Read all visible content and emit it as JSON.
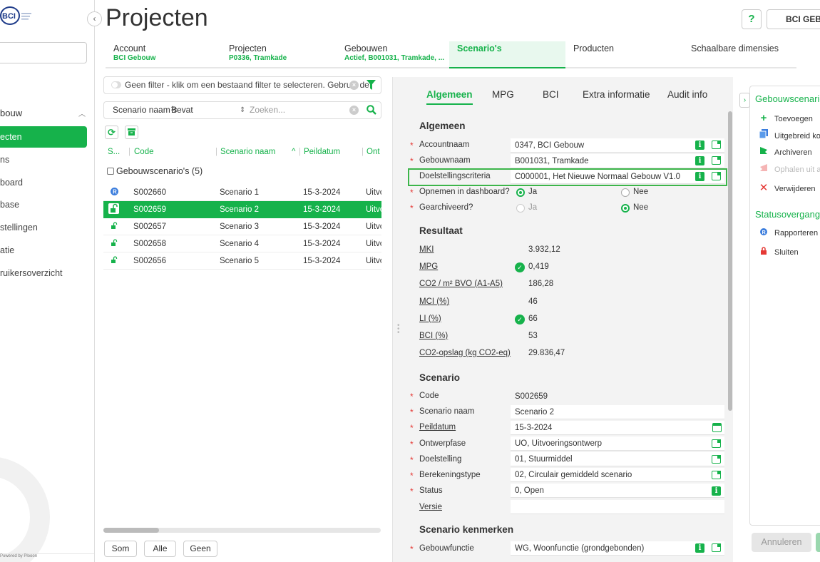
{
  "header": {
    "title": "Projecten",
    "help_label": "?",
    "org_label": "BCI GEBOUW"
  },
  "sidebar": {
    "logo_text": "BCI",
    "group_label": "bouw",
    "items": [
      "ecten",
      "ns",
      "board",
      "base",
      "stellingen",
      "atie",
      "ruikersoverzicht"
    ],
    "active_index": 0,
    "powered": "Powered by Plooon"
  },
  "crumbs": [
    {
      "label": "Account",
      "sub": "BCI Gebouw"
    },
    {
      "label": "Projecten",
      "sub": "P0336, Tramkade"
    },
    {
      "label": "Gebouwen",
      "sub": "Actief, B001031, Tramkade, ..."
    },
    {
      "label": "Scenario's",
      "sub": ""
    },
    {
      "label": "Producten",
      "sub": ""
    },
    {
      "label": "Schaalbare dimensies",
      "sub": ""
    }
  ],
  "list": {
    "filter_text": "Geen filter - klik om een bestaand filter te selecteren. Gebruik de",
    "search_field": "Scenario naam",
    "search_operator": "Bevat",
    "search_placeholder": "Zoeken...",
    "columns": [
      "S...",
      "Code",
      "Scenario naam",
      "Peildatum",
      "Ont"
    ],
    "group_label": "Gebouwscenario's (5)",
    "rows": [
      {
        "icon": "R",
        "code": "S002660",
        "name": "Scenario 1",
        "date": "15-3-2024",
        "phase": "Uitvo"
      },
      {
        "icon": "open-lock",
        "code": "S002659",
        "name": "Scenario 2",
        "date": "15-3-2024",
        "phase": "Uitvo"
      },
      {
        "icon": "open-lock",
        "code": "S002657",
        "name": "Scenario 3",
        "date": "15-3-2024",
        "phase": "Uitvo"
      },
      {
        "icon": "open-lock",
        "code": "S002658",
        "name": "Scenario 4",
        "date": "15-3-2024",
        "phase": "Uitvo"
      },
      {
        "icon": "open-lock",
        "code": "S002656",
        "name": "Scenario 5",
        "date": "15-3-2024",
        "phase": "Uitvo"
      }
    ],
    "selected_index": 1,
    "buttons": [
      "Som",
      "Alle",
      "Geen"
    ]
  },
  "detail": {
    "tabs": [
      "Algemeen",
      "MPG",
      "BCI",
      "Extra informatie",
      "Audit info"
    ],
    "sections": {
      "algemeen": "Algemeen",
      "resultaat": "Resultaat",
      "scenario": "Scenario",
      "kenmerken": "Scenario kenmerken"
    },
    "algemeen": {
      "accountnaam": {
        "label": "Accountnaam",
        "value": "0347, BCI Gebouw"
      },
      "gebouwnaam": {
        "label": "Gebouwnaam",
        "value": "B001031, Tramkade"
      },
      "doelstellingscriteria": {
        "label": "Doelstellingscriteria",
        "value": "C000001, Het Nieuwe Normaal Gebouw V1.0"
      },
      "opnemen": {
        "label": "Opnemen in dashboard?",
        "yes": "Ja",
        "no": "Nee",
        "value": "Ja"
      },
      "gearchiveerd": {
        "label": "Gearchiveerd?",
        "yes": "Ja",
        "no": "Nee",
        "value": "Nee"
      }
    },
    "resultaat": [
      {
        "label": "MKI",
        "value": "3.932,12",
        "ok": false
      },
      {
        "label": "MPG",
        "value": "0,419",
        "ok": true
      },
      {
        "label": "CO2 / m² BVO (A1-A5)",
        "value": "186,28",
        "ok": false
      },
      {
        "label": "MCI (%)",
        "value": "46",
        "ok": false
      },
      {
        "label": "LI (%)",
        "value": "66",
        "ok": true
      },
      {
        "label": "BCI (%)",
        "value": "53",
        "ok": false
      },
      {
        "label": "CO2-opslag (kg CO2-eq)",
        "value": "29.836,47",
        "ok": false
      }
    ],
    "scenario": {
      "code": {
        "label": "Code",
        "value": "S002659"
      },
      "naam": {
        "label": "Scenario naam",
        "value": "Scenario 2"
      },
      "peildatum": {
        "label": "Peildatum",
        "value": "15-3-2024"
      },
      "ontwerpfase": {
        "label": "Ontwerpfase",
        "value": "UO, Uitvoeringsontwerp"
      },
      "doelstelling": {
        "label": "Doelstelling",
        "value": "01, Stuurmiddel"
      },
      "berekeningstype": {
        "label": "Berekeningstype",
        "value": "02, Circulair gemiddeld scenario"
      },
      "status": {
        "label": "Status",
        "value": "0, Open"
      },
      "versie": {
        "label": "Versie",
        "value": ""
      }
    },
    "kenmerken": {
      "gebouwfunctie": {
        "label": "Gebouwfunctie",
        "value": "WG, Woonfunctie (grondgebonden)"
      }
    }
  },
  "actions": {
    "title": "Gebouwscenario's",
    "items": [
      {
        "icon": "+",
        "label": "Toevoegen",
        "disabled": false
      },
      {
        "icon": "copy",
        "label": "Uitgebreid kopiëren",
        "disabled": false
      },
      {
        "icon": "archive",
        "label": "Archiveren",
        "disabled": false
      },
      {
        "icon": "restore",
        "label": "Ophalen uit archief",
        "disabled": true
      },
      {
        "icon": "×",
        "label": "Verwijderen",
        "disabled": false
      }
    ],
    "status_title": "Statusovergangen",
    "status_items": [
      {
        "icon": "R",
        "label": "Rapporteren"
      },
      {
        "icon": "lock",
        "label": "Sluiten"
      }
    ],
    "cancel_label": "Annuleren"
  }
}
